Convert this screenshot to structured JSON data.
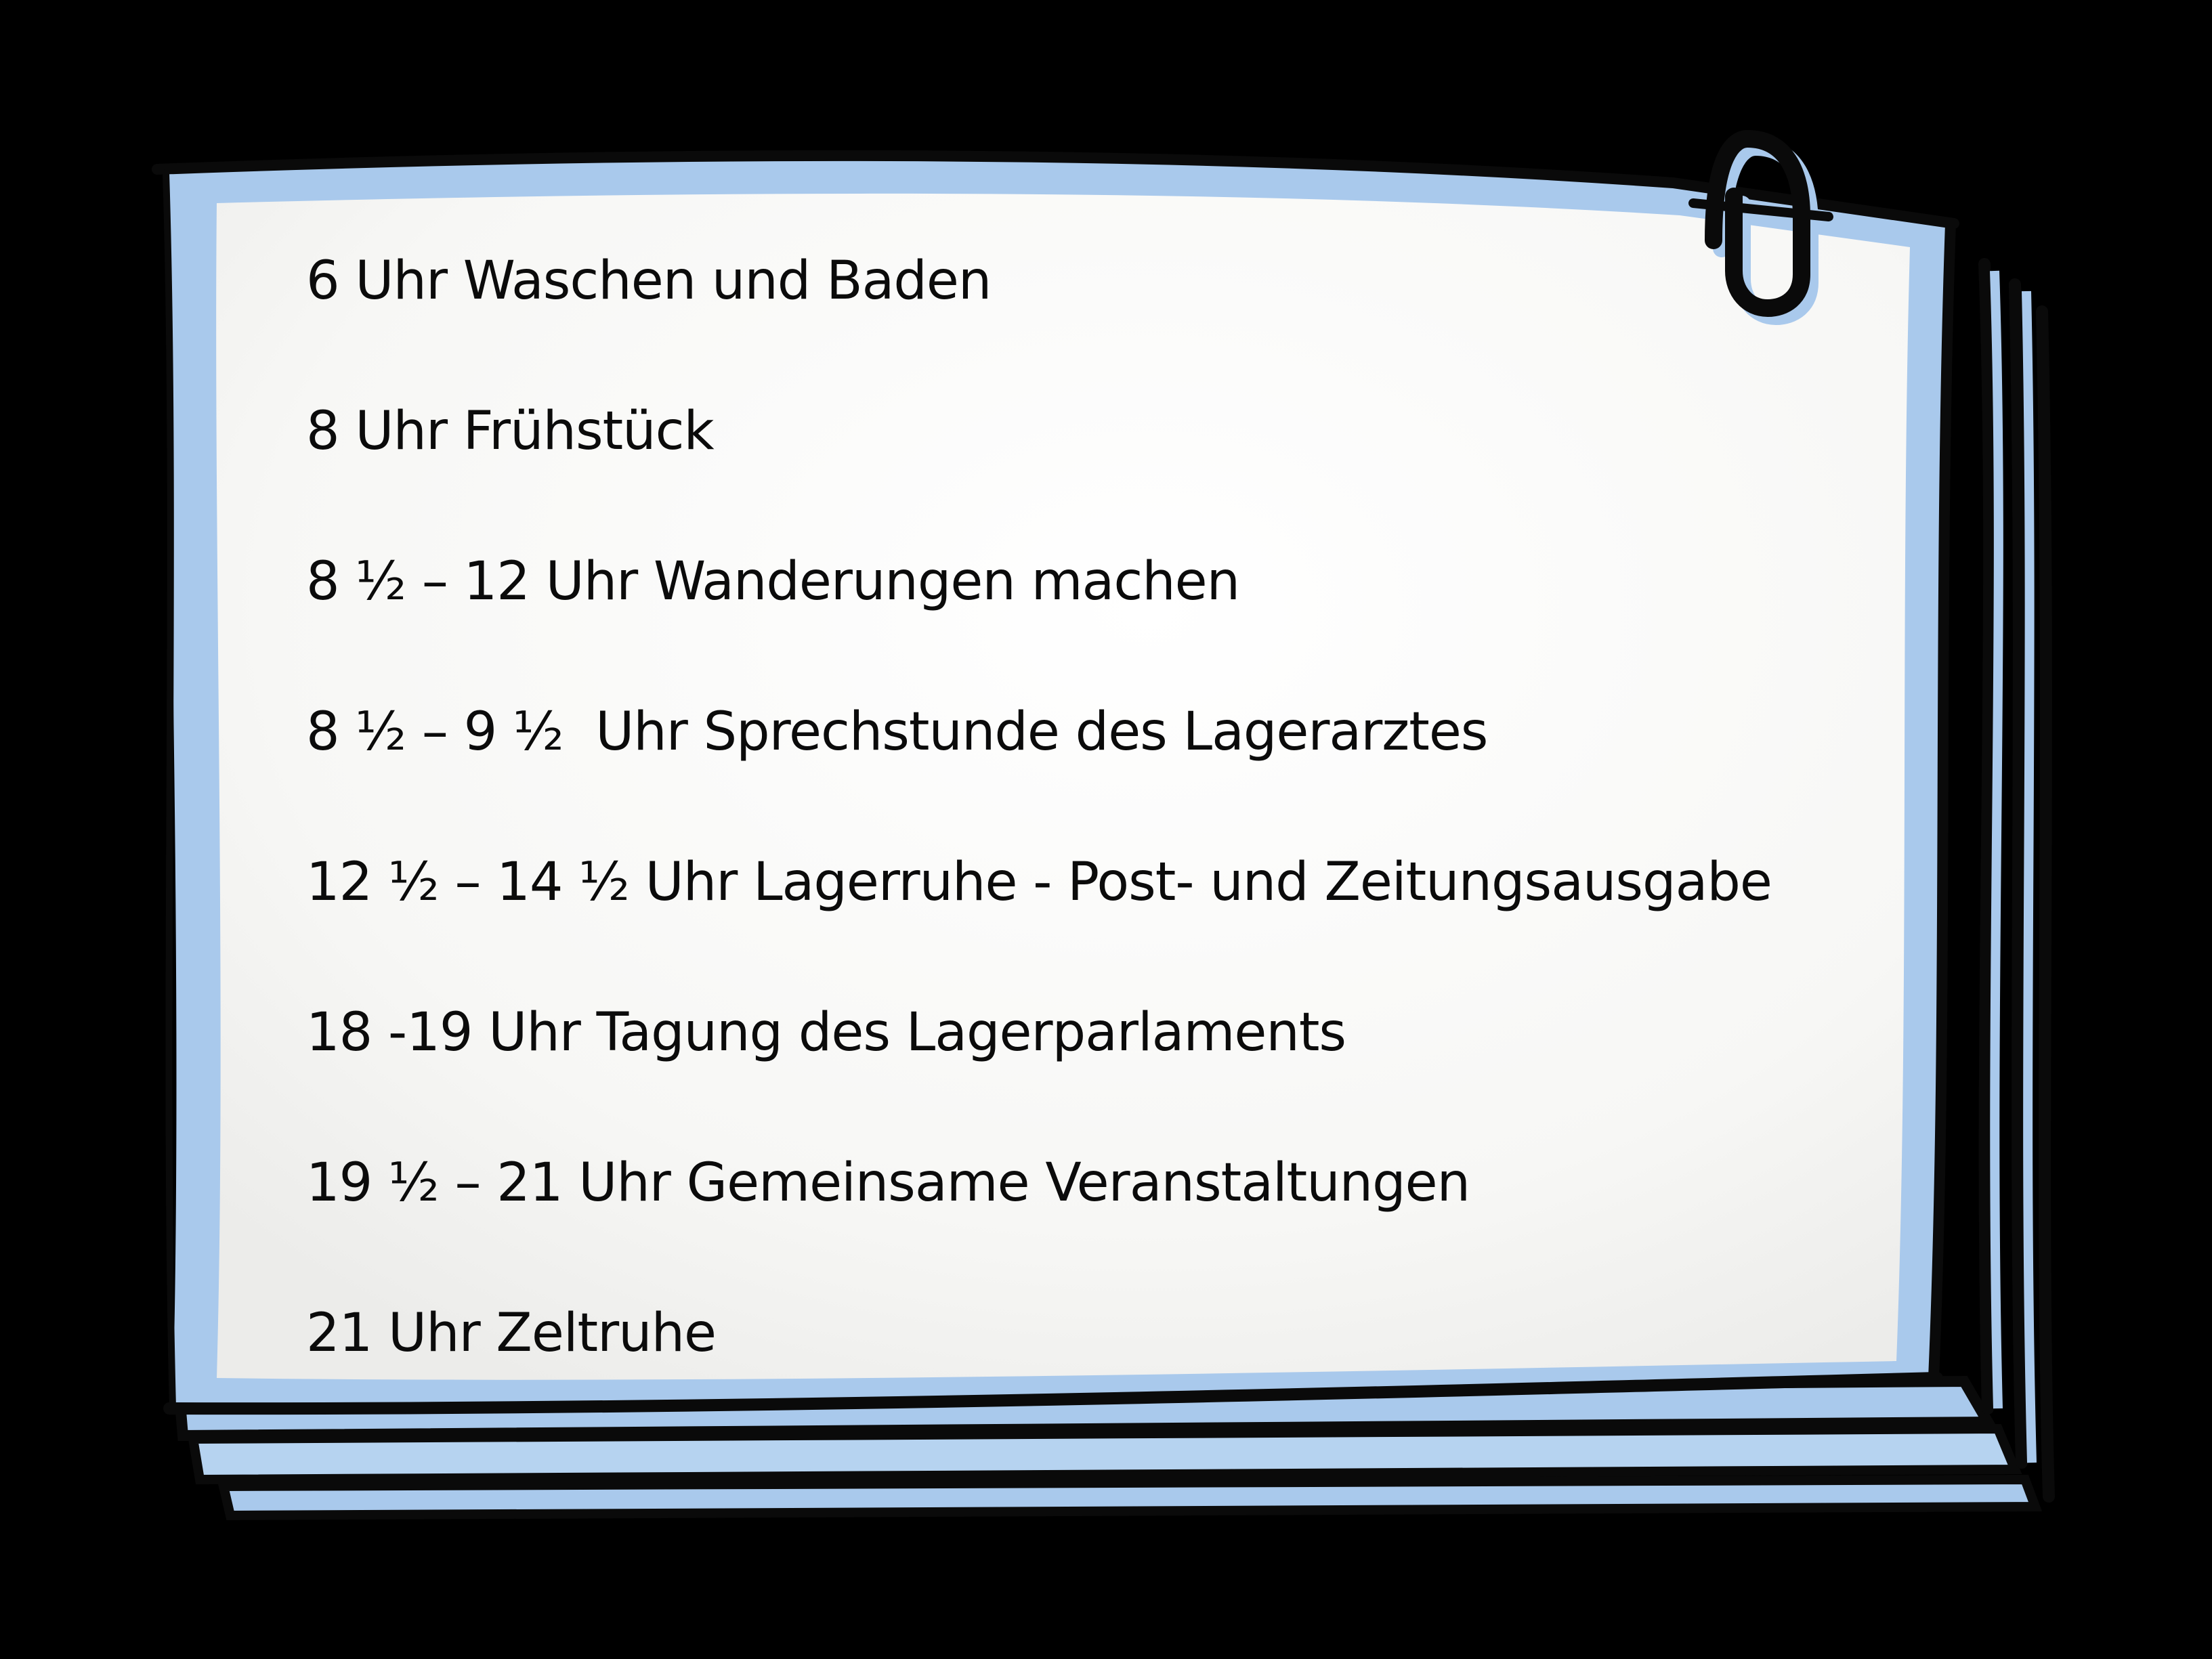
{
  "colors": {
    "background": "#000000",
    "paper": "#fbfbf9",
    "frame_blue": "#a9c9ec",
    "frame_ink": "#0a0a0a",
    "text": "#0b0b0b"
  },
  "decorations": {
    "clip_icon": "paper-clip-icon",
    "frame": "hand-drawn-stacked-paper-frame"
  },
  "schedule": [
    "6 Uhr Waschen und Baden",
    "8 Uhr Frühstück",
    "8 ½ – 12 Uhr Wanderungen machen",
    "8 ½ – 9 ½  Uhr Sprechstunde des Lagerarztes",
    "12 ½ – 14 ½ Uhr Lagerruhe - Post- und Zeitungsausgabe",
    "18 -19 Uhr Tagung des Lagerparlaments",
    "19 ½ – 21 Uhr Gemeinsame Veranstaltungen",
    "21 Uhr Zeltruhe"
  ]
}
